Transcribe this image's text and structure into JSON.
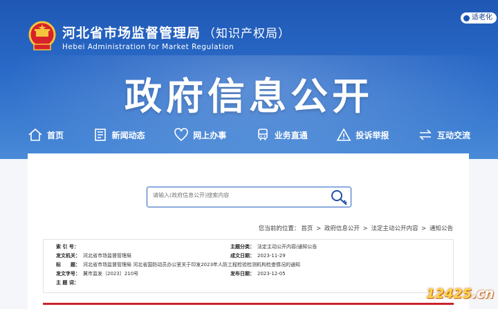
{
  "header": {
    "name": "河北省市场监督管理局",
    "name_paren": "（知识产权局）",
    "name_en": "Hebei Administration for Market Regulation",
    "elder_mode": "适老化",
    "big_title": "政府信息公开"
  },
  "nav": [
    {
      "label": "首页",
      "icon": "home-icon"
    },
    {
      "label": "新闻动态",
      "icon": "news-icon"
    },
    {
      "label": "网上办事",
      "icon": "heart-icon"
    },
    {
      "label": "业务直通",
      "icon": "train-icon"
    },
    {
      "label": "投诉举报",
      "icon": "warning-icon"
    },
    {
      "label": "互动交流",
      "icon": "exchange-icon"
    }
  ],
  "search": {
    "placeholder": "请输入(政府信息公开)搜索内容"
  },
  "breadcrumb": {
    "prefix": "您当前的位置：",
    "items": [
      "首页",
      "政府信息公开",
      "法定主动公开内容",
      "通知公告"
    ],
    "sep": ">"
  },
  "info": {
    "index_no_label": "索 引 号：",
    "index_no": "",
    "theme_label": "主题分类：",
    "theme": "法定主动公开内容/通知公告",
    "issuer_label": "发文机关：",
    "issuer": "河北省市场监督管理局",
    "date_label": "成文日期：",
    "date": "2023-11-29",
    "title_label": "标　　题：",
    "title": "河北省市场监督管理局 河北省国防动员办公室关于印发2023年人防工程检验检测机构检查情况的通知",
    "doc_no_label": "发文字号：",
    "doc_no": "冀市监发〔2023〕210号",
    "pub_date_label": "发布日期：",
    "pub_date": "2023-12-05",
    "keywords_label": "主 题 词：",
    "keywords": ""
  },
  "watermark": {
    "text": "12425",
    "suffix": ".cn"
  },
  "colors": {
    "primary": "#1f58b4",
    "accent_red": "#c8232c"
  }
}
